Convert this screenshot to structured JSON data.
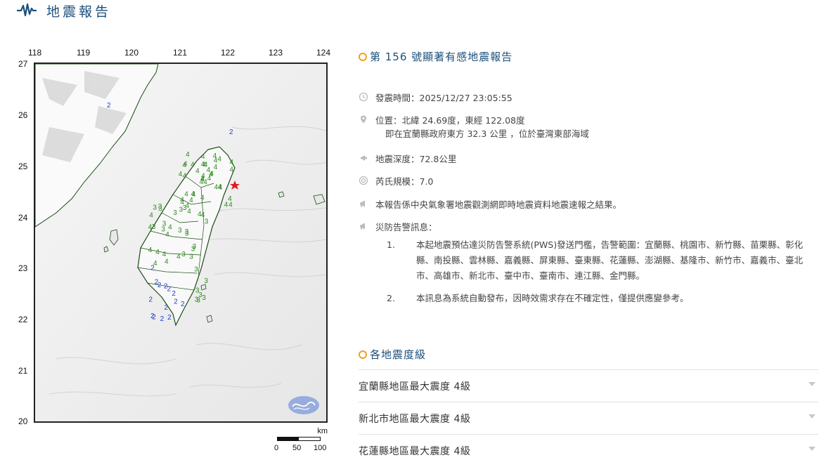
{
  "header": {
    "title": "地震報告",
    "icon": "seismic-wave-icon"
  },
  "map": {
    "lon_labels": [
      "118",
      "119",
      "120",
      "121",
      "122",
      "123",
      "124"
    ],
    "lat_labels": [
      "27",
      "26",
      "25",
      "24",
      "23",
      "22",
      "21",
      "20"
    ],
    "scale": {
      "unit": "km",
      "ticks": [
        "0",
        "50",
        "100"
      ]
    },
    "intensity_marks": {
      "north": [
        "4",
        "4",
        "4",
        "4",
        "4",
        "4",
        "4",
        "4",
        "4",
        "4",
        "4",
        "4",
        "4",
        "4",
        "4",
        "4",
        "4",
        "4",
        "4",
        "4",
        "4",
        "4",
        "4",
        "4",
        "4",
        "4",
        "4",
        "4",
        "4",
        "4",
        "4",
        "4",
        "4",
        "4",
        "4",
        "4",
        "4",
        "4",
        "4",
        "4"
      ],
      "central": [
        "3",
        "4",
        "3",
        "3",
        "4",
        "4",
        "3",
        "4",
        "4",
        "3",
        "4",
        "3",
        "4",
        "3",
        "3",
        "4",
        "3",
        "3",
        "3",
        "4",
        "3",
        "4",
        "3",
        "3",
        "4",
        "3",
        "4",
        "3",
        "3",
        "4"
      ],
      "south_blue": [
        "2",
        "2",
        "2",
        "2",
        "2",
        "2",
        "2",
        "2",
        "2",
        "2",
        "2",
        "2",
        "2",
        "2"
      ],
      "east": [
        "3",
        "3",
        "3",
        "3",
        "3",
        "3",
        "3"
      ],
      "offshore": [
        "2",
        "2"
      ]
    },
    "colors": {
      "int4": "#2f8a1f",
      "int3": "#2f8a1f",
      "int2": "#1f3bd1",
      "epicenter": "#e11b22",
      "coast": "#1c4d16",
      "logo": "#8ea6dd"
    }
  },
  "report": {
    "title": "第 156 號顯著有感地震報告",
    "time_text": "發震時間：2025/12/27 23:05:55",
    "location_text": "位置：北緯 24.69度，東經 122.08度",
    "location_sub": "即在宜蘭縣政府東方 32.3 公里 ，位於臺灣東部海域",
    "depth_text": "地震深度：72.8公里",
    "magnitude_text": "芮氏規模：7.0",
    "note_text": "本報告係中央氣象署地震觀測網即時地震資料地震速報之結果。",
    "warning_title": "災防告警訊息：",
    "warnings": [
      {
        "num": "1.",
        "text": "本起地震預估達災防告警系統(PWS)發送門檻，告警範圍：宜蘭縣、桃園市、新竹縣、苗栗縣、彰化縣、南投縣、雲林縣、嘉義縣、屏東縣、臺東縣、花蓮縣、澎湖縣、基隆市、新竹市、嘉義市、臺北市、高雄市、新北市、臺中市、臺南市、連江縣、金門縣。"
      },
      {
        "num": "2.",
        "text": "本訊息為系統自動發布，因時效需求存在不確定性，僅提供應變參考。"
      }
    ]
  },
  "intensity_section": {
    "title": "各地震度級",
    "items": [
      {
        "label": "宜蘭縣地區最大震度 4級"
      },
      {
        "label": "新北市地區最大震度 4級"
      },
      {
        "label": "花蓮縣地區最大震度 4級"
      }
    ]
  }
}
